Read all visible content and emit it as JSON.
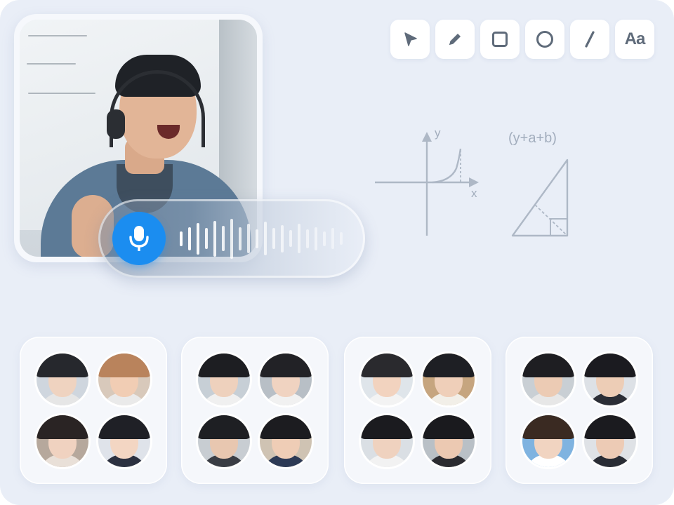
{
  "classroom": {
    "teacher_video": {
      "whiteboard_scribbles": 3,
      "mic_active": true
    },
    "voice_meter": {
      "bars": [
        0.35,
        0.55,
        0.75,
        0.5,
        0.85,
        0.6,
        0.95,
        0.55,
        0.7,
        0.45,
        0.8,
        0.5,
        0.65,
        0.4,
        0.7,
        0.45,
        0.55,
        0.35,
        0.5,
        0.3
      ]
    },
    "toolbar": {
      "tools": [
        {
          "name": "select-tool",
          "icon": "cursor-arrow-icon"
        },
        {
          "name": "pen-tool",
          "icon": "pencil-icon"
        },
        {
          "name": "rectangle-tool",
          "icon": "square-icon"
        },
        {
          "name": "circle-tool",
          "icon": "circle-icon"
        },
        {
          "name": "line-tool",
          "icon": "line-icon"
        },
        {
          "name": "text-tool",
          "icon": "text-icon",
          "label": "Aa"
        }
      ]
    },
    "canvas": {
      "graph_y_label": "y",
      "graph_x_label": "x",
      "equation": "(y+a+b)"
    },
    "colors": {
      "accent": "#1b8df0",
      "tool_icon": "#5f6b7a",
      "drawing_stroke": "#aeb8c6",
      "background": "#e9eef7"
    },
    "student_groups": [
      {
        "avatars": [
          {
            "skin": "#efd3c0",
            "hair": "#26282d",
            "shirt": "#e6e6e6",
            "bg": "#cfd6de"
          },
          {
            "skin": "#f1cdb4",
            "hair": "#b9835c",
            "shirt": "#eaeaea",
            "bg": "#d8c9bb"
          },
          {
            "skin": "#f0d2c0",
            "hair": "#2a2424",
            "shirt": "#e9e0d8",
            "bg": "#b6a89c"
          },
          {
            "skin": "#f3d6c3",
            "hair": "#1f2026",
            "shirt": "#2c3140",
            "bg": "#dfe3ea"
          }
        ]
      },
      {
        "avatars": [
          {
            "skin": "#eed1bd",
            "hair": "#1d1e22",
            "shirt": "#f0f0f0",
            "bg": "#c7cfd6"
          },
          {
            "skin": "#f0d3c1",
            "hair": "#222226",
            "shirt": "#f1f1f1",
            "bg": "#b8bfc6"
          },
          {
            "skin": "#e8c7b0",
            "hair": "#1e1f23",
            "shirt": "#3a3d44",
            "bg": "#c8cdd2"
          },
          {
            "skin": "#efcdb6",
            "hair": "#1c1c20",
            "shirt": "#2d3a55",
            "bg": "#cfc3b3"
          }
        ]
      },
      {
        "avatars": [
          {
            "skin": "#f2d3bf",
            "hair": "#2a2a2e",
            "shirt": "#f3f3f3",
            "bg": "#dfe5ea"
          },
          {
            "skin": "#efcfb9",
            "hair": "#1e1f24",
            "shirt": "#f2efe8",
            "bg": "#c6a57f"
          },
          {
            "skin": "#efd2bf",
            "hair": "#1b1b1f",
            "shirt": "#f2f2f2",
            "bg": "#dadfe4"
          },
          {
            "skin": "#ecc9b2",
            "hair": "#1a1a1e",
            "shirt": "#2b2b30",
            "bg": "#b9c0c6"
          }
        ]
      },
      {
        "avatars": [
          {
            "skin": "#eccbb4",
            "hair": "#1e1e22",
            "shirt": "#e7e7e7",
            "bg": "#c9cfd4"
          },
          {
            "skin": "#edcdb6",
            "hair": "#1b1b20",
            "shirt": "#2b2e36",
            "bg": "#dde1e6"
          },
          {
            "skin": "#f1d4c1",
            "hair": "#3a2a22",
            "shirt": "#ffffff",
            "bg": "#7fb3e0"
          },
          {
            "skin": "#edcbb5",
            "hair": "#1b1b1f",
            "shirt": "#2a2d35",
            "bg": "#dfe2e6"
          }
        ]
      }
    ]
  }
}
